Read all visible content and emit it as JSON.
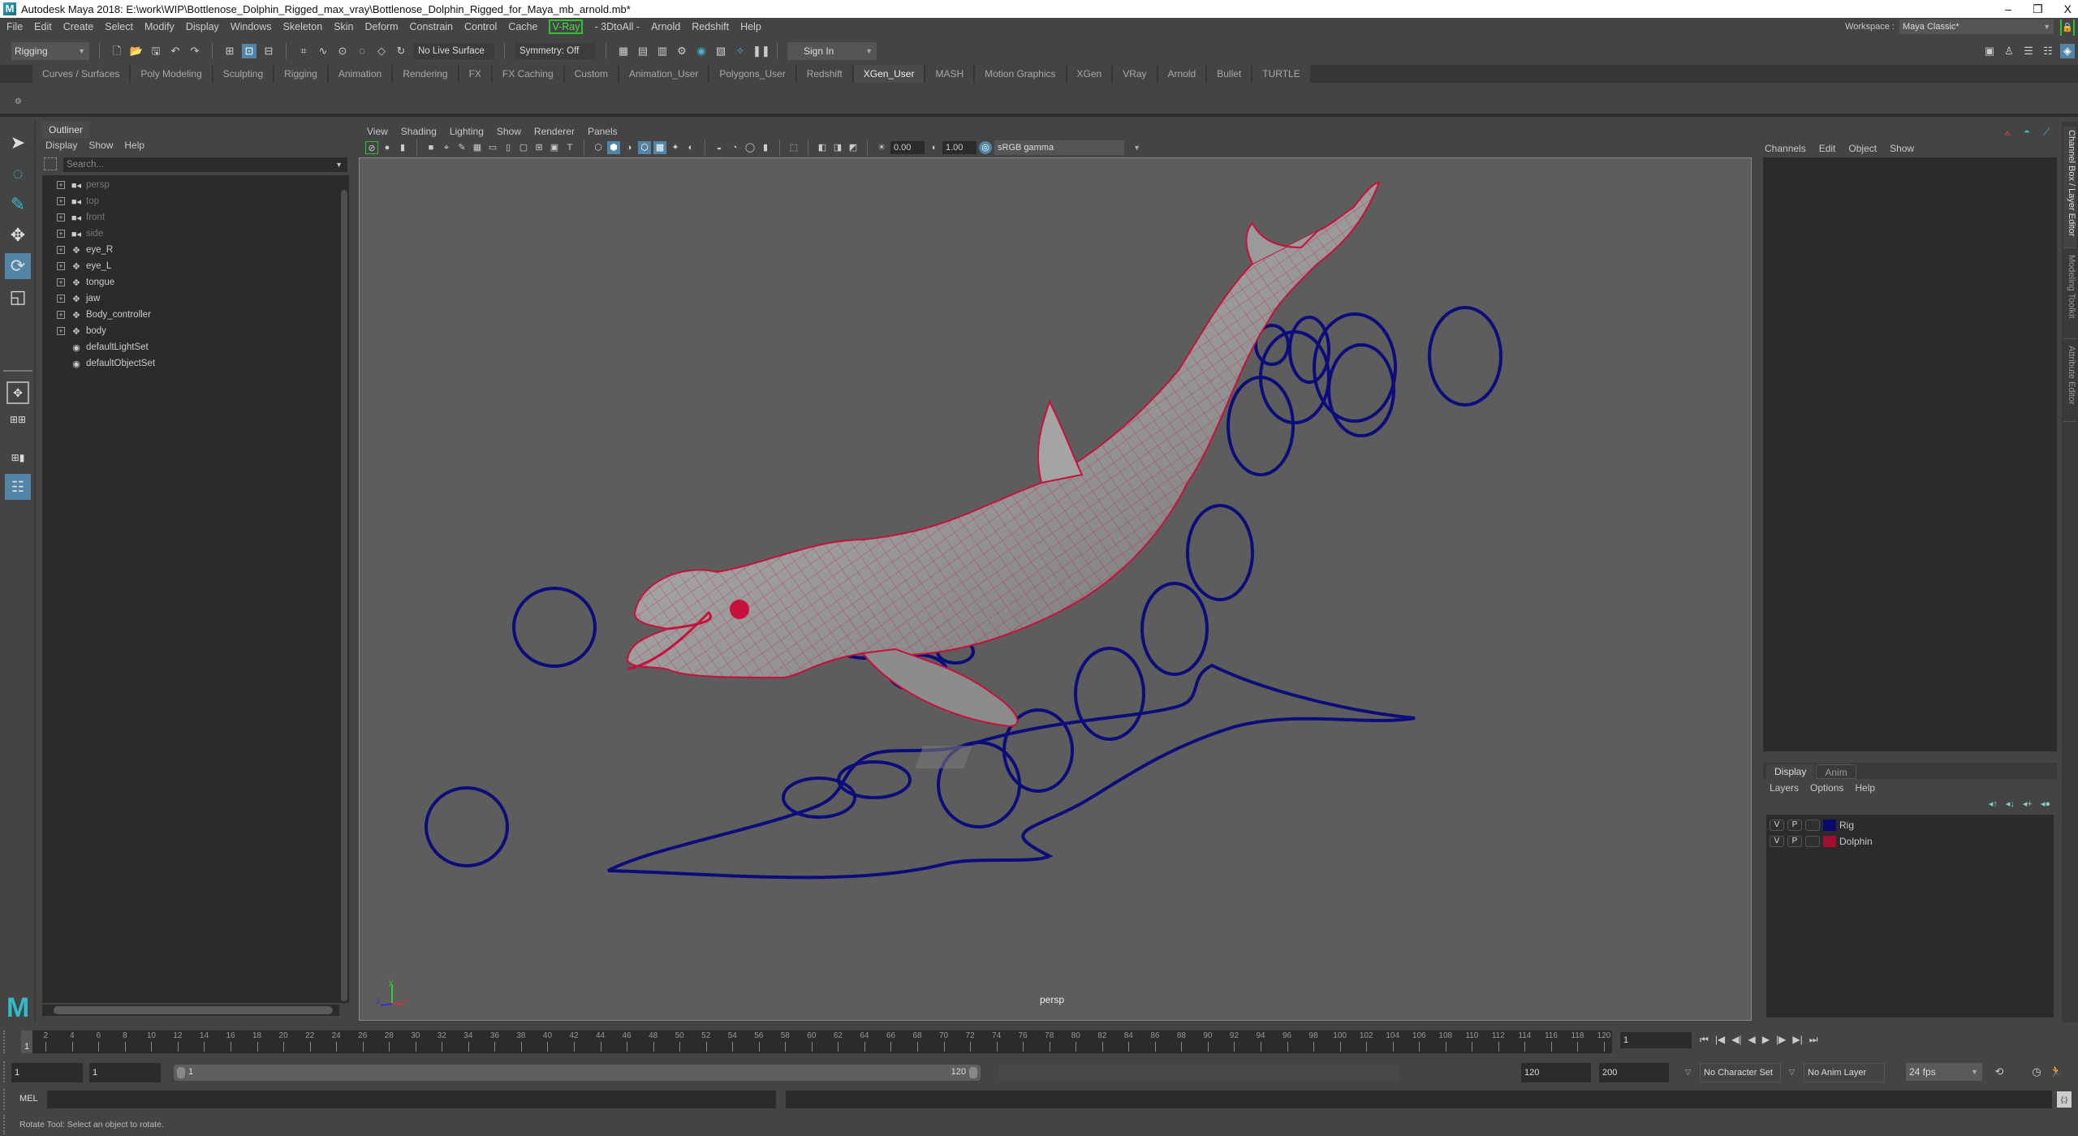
{
  "window": {
    "title": "Autodesk Maya 2018: E:\\work\\WIP\\Bottlenose_Dolphin_Rigged_max_vray\\Bottlenose_Dolphin_Rigged_for_Maya_mb_arnold.mb*",
    "minimize": "–",
    "maximize": "❐",
    "close": "X"
  },
  "menubar": {
    "items": [
      "File",
      "Edit",
      "Create",
      "Select",
      "Modify",
      "Display",
      "Windows",
      "Skeleton",
      "Skin",
      "Deform",
      "Constrain",
      "Control",
      "Cache",
      "V-Ray",
      "- 3DtoAll -",
      "Arnold",
      "Redshift",
      "Help"
    ],
    "workspace_label": "Workspace :",
    "workspace_value": "Maya Classic*"
  },
  "statusline": {
    "menuset": "Rigging",
    "live_surface": "No Live Surface",
    "symmetry": "Symmetry: Off",
    "sign_in": "Sign In"
  },
  "shelf": {
    "tabs": [
      "Curves / Surfaces",
      "Poly Modeling",
      "Sculpting",
      "Rigging",
      "Animation",
      "Rendering",
      "FX",
      "FX Caching",
      "Custom",
      "Animation_User",
      "Polygons_User",
      "Redshift",
      "XGen_User",
      "MASH",
      "Motion Graphics",
      "XGen",
      "VRay",
      "Arnold",
      "Bullet",
      "TURTLE"
    ],
    "active_tab": "XGen_User"
  },
  "toolbox": {
    "tools": [
      {
        "name": "select-tool",
        "glyph": "➤"
      },
      {
        "name": "lasso-tool",
        "glyph": "⭘"
      },
      {
        "name": "paint-select-tool",
        "glyph": "✎"
      },
      {
        "name": "move-tool",
        "glyph": "✥"
      },
      {
        "name": "rotate-tool",
        "glyph": "⟳",
        "active": true
      },
      {
        "name": "scale-tool",
        "glyph": "◱"
      }
    ],
    "logo": "M"
  },
  "outliner": {
    "title": "Outliner",
    "menu": [
      "Display",
      "Show",
      "Help"
    ],
    "search_placeholder": "Search...",
    "items": [
      {
        "label": "persp",
        "type": "camera",
        "dim": true,
        "expandable": true
      },
      {
        "label": "top",
        "type": "camera",
        "dim": true,
        "expandable": true
      },
      {
        "label": "front",
        "type": "camera",
        "dim": true,
        "expandable": true
      },
      {
        "label": "side",
        "type": "camera",
        "dim": true,
        "expandable": true
      },
      {
        "label": "eye_R",
        "type": "transform",
        "dim": false,
        "expandable": true
      },
      {
        "label": "eye_L",
        "type": "transform",
        "dim": false,
        "expandable": true
      },
      {
        "label": "tongue",
        "type": "transform",
        "dim": false,
        "expandable": true
      },
      {
        "label": "jaw",
        "type": "transform",
        "dim": false,
        "expandable": true
      },
      {
        "label": "Body_controller",
        "type": "transform",
        "dim": false,
        "expandable": true
      },
      {
        "label": "body",
        "type": "transform",
        "dim": false,
        "expandable": true
      },
      {
        "label": "defaultLightSet",
        "type": "set",
        "dim": false,
        "expandable": false
      },
      {
        "label": "defaultObjectSet",
        "type": "set",
        "dim": false,
        "expandable": false
      }
    ]
  },
  "viewport": {
    "menu": [
      "View",
      "Shading",
      "Lighting",
      "Show",
      "Renderer",
      "Panels"
    ],
    "exposure": "0.00",
    "gamma": "1.00",
    "color_space": "sRGB gamma",
    "camera_label": "persp",
    "axis": {
      "x": "x",
      "y": "y",
      "z": "z"
    },
    "colors": {
      "mesh_wire": "#c8103c",
      "rig_curves": "#0c0c7a",
      "background": "#5d5d5d"
    }
  },
  "channelbox": {
    "menu": [
      "Channels",
      "Edit",
      "Object",
      "Show"
    ],
    "side_tabs": [
      "Channel Box / Layer Editor",
      "Modeling Toolkit",
      "Attribute Editor"
    ]
  },
  "layer_editor": {
    "tabs": [
      "Display",
      "Anim"
    ],
    "active_tab": "Display",
    "menu": [
      "Layers",
      "Options",
      "Help"
    ],
    "layers": [
      {
        "v": "V",
        "p": "P",
        "name": "Rig",
        "color": "#0a0a6e"
      },
      {
        "v": "V",
        "p": "P",
        "name": "Dolphin",
        "color": "#a0102e"
      }
    ]
  },
  "timeslider": {
    "current_frame": "1",
    "tick_labels": [
      "2",
      "4",
      "6",
      "8",
      "10",
      "12",
      "14",
      "16",
      "18",
      "20",
      "22",
      "24",
      "26",
      "28",
      "30",
      "32",
      "34",
      "36",
      "38",
      "40",
      "42",
      "44",
      "46",
      "48",
      "50",
      "52",
      "54",
      "56",
      "58",
      "60",
      "62",
      "64",
      "66",
      "68",
      "70",
      "72",
      "74",
      "76",
      "78",
      "80",
      "82",
      "84",
      "86",
      "88",
      "90",
      "92",
      "94",
      "96",
      "98",
      "100",
      "102",
      "104",
      "106",
      "108",
      "110",
      "112",
      "114",
      "116",
      "118",
      "120"
    ],
    "current_frame_field": "1",
    "playback_buttons": [
      "⏮",
      "|◀",
      "◀|",
      "◀",
      "▶",
      "|▶",
      "▶|",
      "⏭"
    ]
  },
  "rangeslider": {
    "start_time": "1",
    "playback_start": "1",
    "range_start_label": "1",
    "range_end_label": "120",
    "playback_end": "120",
    "end_time": "200",
    "character_set": "No Character Set",
    "anim_layer": "No Anim Layer",
    "fps": "24 fps"
  },
  "commandline": {
    "label": "MEL"
  },
  "helpline": {
    "text": "Rotate Tool: Select an object to rotate."
  }
}
